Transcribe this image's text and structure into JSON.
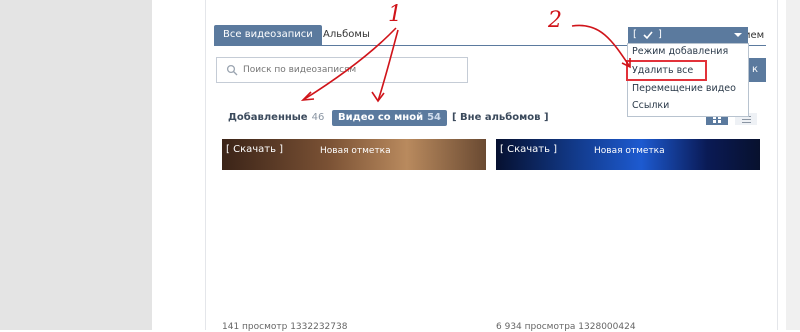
{
  "tabs": {
    "all_videos": "Все видеозаписи",
    "albums": "Альбомы",
    "right_peek": "ием"
  },
  "search": {
    "placeholder": "Поиск по видеозаписям",
    "button_peek": "к"
  },
  "filters": {
    "added_label": "Добавленные",
    "added_count": "46",
    "tagged_label": "Видео со мной",
    "tagged_count": "54",
    "no_album_label": "[ Вне альбомов ]"
  },
  "dropdown": {
    "selected_prefix": "[",
    "selected_suffix": "]",
    "items": [
      "Режим добавления",
      "Удалить все",
      "Перемещение видео",
      "Ссылки"
    ]
  },
  "videos": [
    {
      "download": "[ Скачать ]",
      "tag": "Новая отметка",
      "meta": "141 просмотр    1332232738"
    },
    {
      "download": "[ Скачать ]",
      "tag": "Новая отметка",
      "meta": "6 934 просмотра    1328000424"
    }
  ],
  "annotations": {
    "label_1": "1",
    "label_2": "2"
  },
  "colors": {
    "accent": "#5b7a9e",
    "highlight": "#e2323a",
    "annotation": "#d0141a"
  }
}
